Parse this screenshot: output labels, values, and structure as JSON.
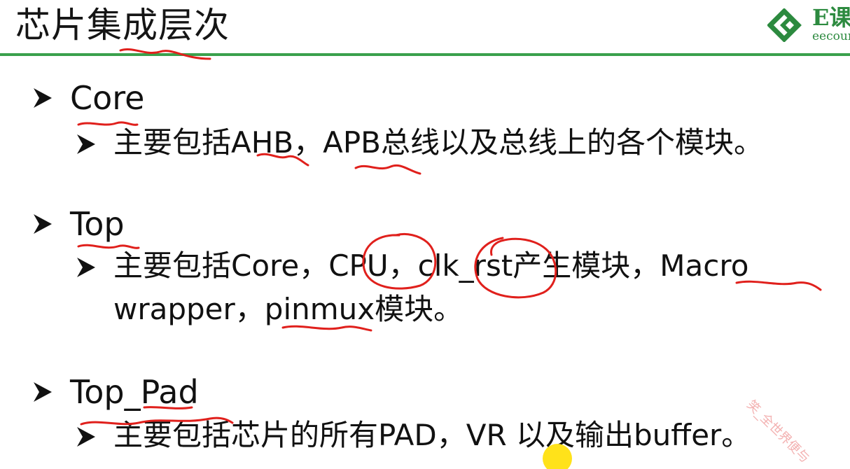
{
  "slide": {
    "title": "芯片集成层次",
    "logo_text": "E课",
    "logo_sub": "eecour",
    "watermark": "笑_全世界便与",
    "sections": [
      {
        "heading": "Core",
        "lines": [
          "主要包括AHB，APB总线以及总线上的各个模块。"
        ]
      },
      {
        "heading": "Top",
        "lines": [
          "主要包括Core，CPU，clk_rst产生模块，Macro",
          "wrapper，pinmux模块。"
        ]
      },
      {
        "heading": "Top_Pad",
        "lines": [
          "主要包括芯片的所有PAD，VR 以及输出buffer。"
        ]
      }
    ]
  },
  "colors": {
    "title_rule": "#3aa04c",
    "logo": "#2c8a3f",
    "annotation": "#e0201c",
    "cursor": "#ffe21a",
    "watermark": "#f3b0b0"
  },
  "icons": {
    "bullet": "arrowhead-bullet-icon",
    "logo": "eecourse-diamond-logo-icon"
  }
}
